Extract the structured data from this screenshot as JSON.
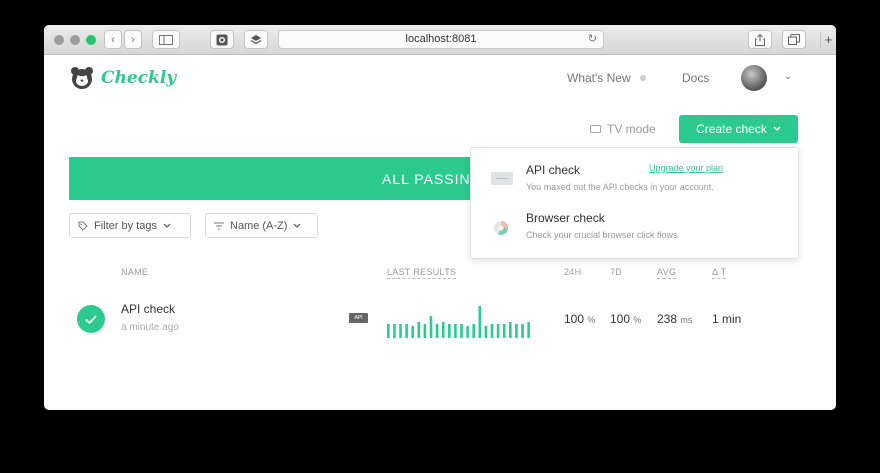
{
  "browser": {
    "url": "localhost:8081"
  },
  "app": {
    "brand": "Checkly",
    "nav": {
      "whats_new": "What's New",
      "docs": "Docs"
    },
    "toolbar": {
      "tv_mode": "TV mode",
      "create_check": "Create check"
    },
    "banner": {
      "text": "ALL PASSIN"
    },
    "filters": {
      "tags": "Filter by tags",
      "sort": "Name (A-Z)"
    },
    "table": {
      "headers": {
        "name": "NAME",
        "last_results": "LAST RESULTS",
        "h24": "24H",
        "d7": "7D",
        "avg": "AVG",
        "delta_t": "Δ T"
      },
      "rows": [
        {
          "name": "API check",
          "time": "a minute ago",
          "badge": "API",
          "h24_value": "100",
          "h24_unit": "%",
          "d7_value": "100",
          "d7_unit": "%",
          "avg_value": "238",
          "avg_unit": "ms",
          "delta_t": "1 min",
          "results": [
            14,
            14,
            14,
            14,
            12,
            16,
            14,
            22,
            14,
            16,
            14,
            14,
            14,
            12,
            14,
            32,
            12,
            14,
            14,
            14,
            16,
            14,
            14,
            16
          ]
        }
      ]
    },
    "dropdown": {
      "items": [
        {
          "title": "API check",
          "subtitle": "You maxed out the API checks in your account.",
          "link": "Upgrade your plan"
        },
        {
          "title": "Browser check",
          "subtitle": "Check your crucial browser click flows."
        }
      ]
    },
    "colors": {
      "accent": "#2dca8f"
    }
  }
}
